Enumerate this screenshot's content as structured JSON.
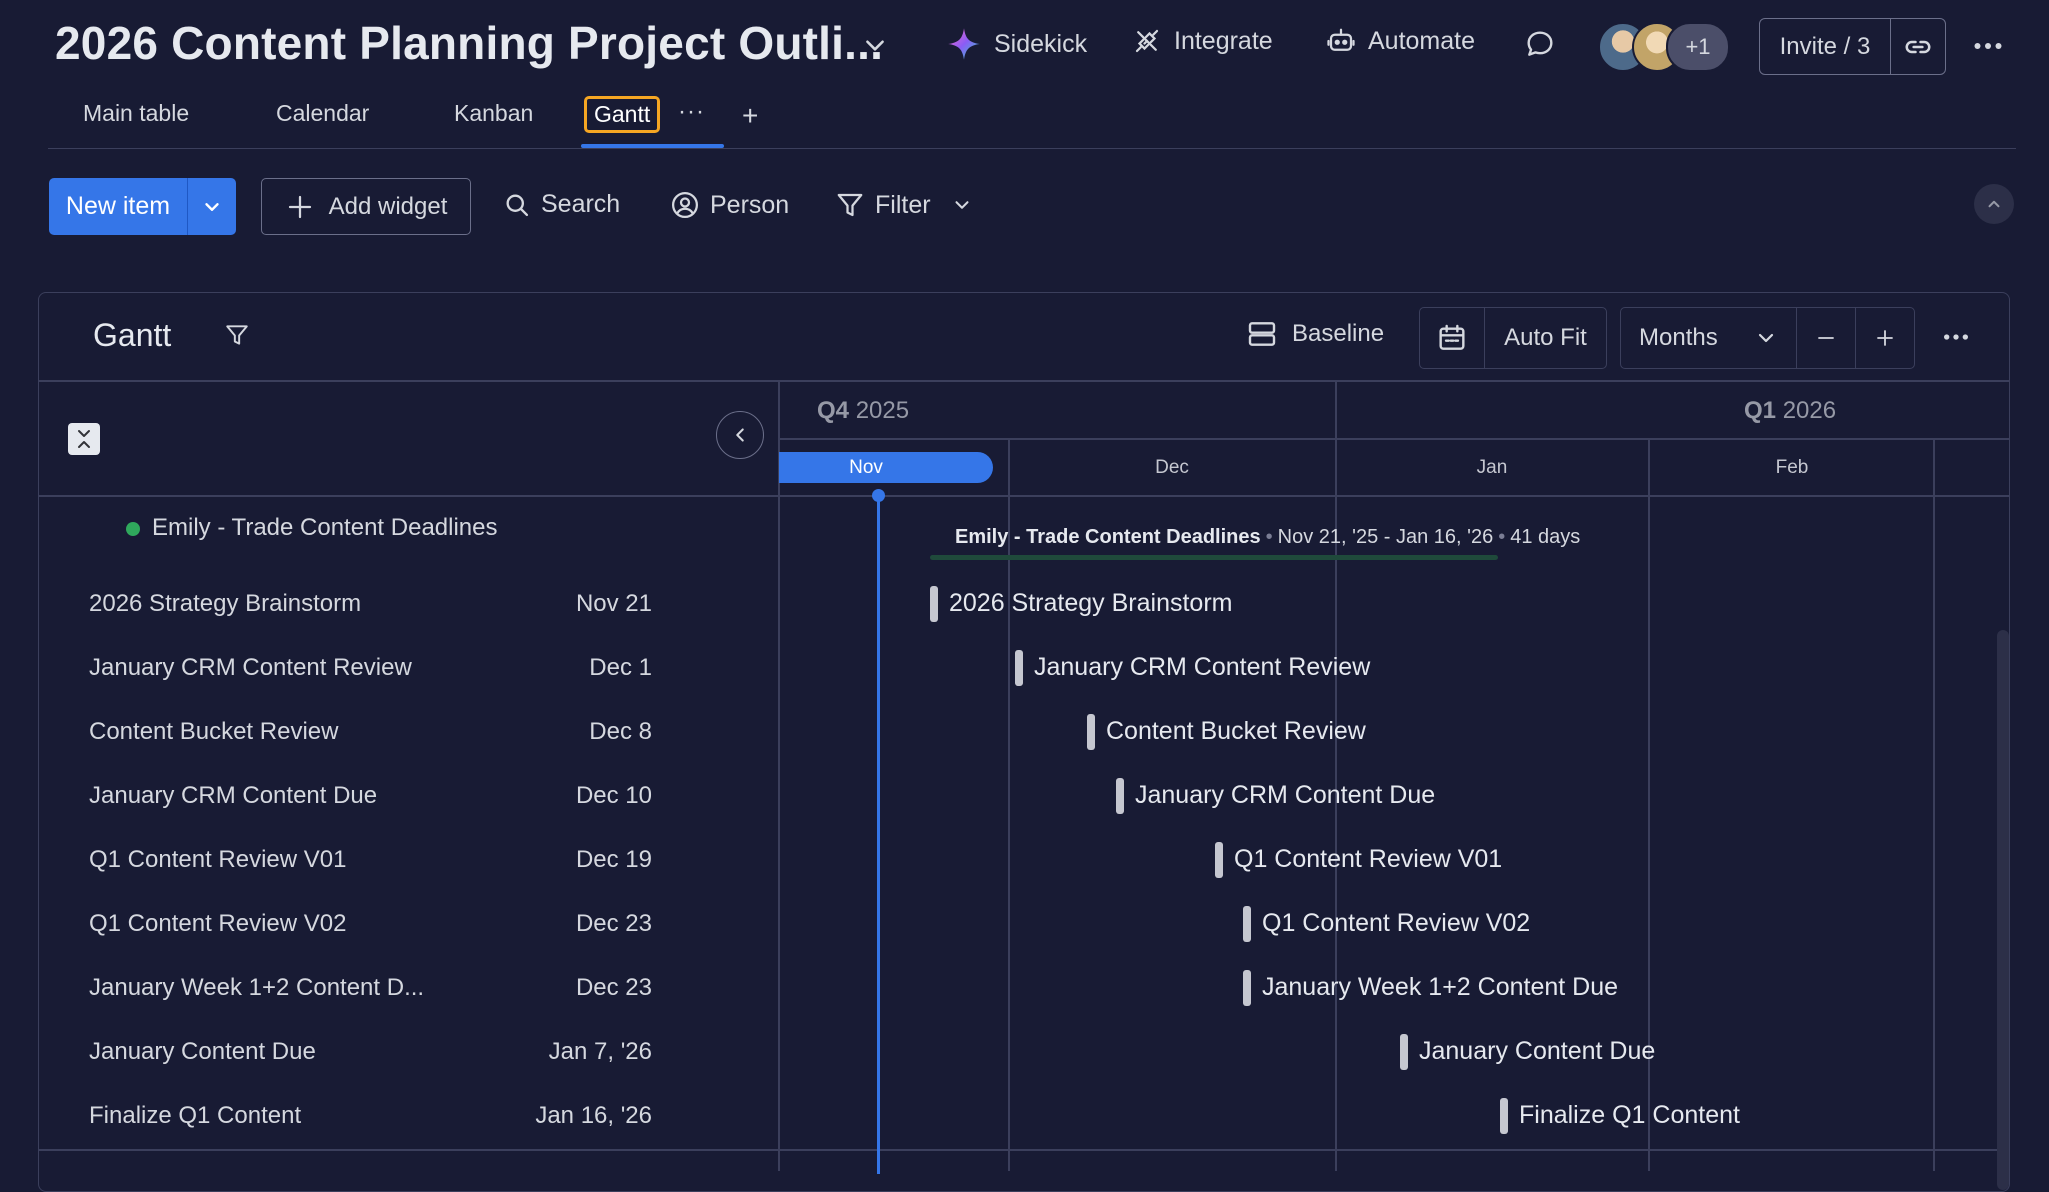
{
  "header": {
    "title": "2026 Content Planning Project Outli...",
    "sidekick_label": "Sidekick",
    "integrate_label": "Integrate",
    "automate_label": "Automate",
    "avatars_more": "+1",
    "invite_label": "Invite / 3"
  },
  "tabs": [
    {
      "label": "Main table"
    },
    {
      "label": "Calendar"
    },
    {
      "label": "Kanban"
    },
    {
      "label": "Gantt",
      "active": true
    }
  ],
  "tab_more": "···",
  "tab_add": "+",
  "toolbar": {
    "new_item_label": "New item",
    "add_widget_label": "Add widget",
    "search_label": "Search",
    "person_label": "Person",
    "filter_label": "Filter"
  },
  "gantt": {
    "title": "Gantt",
    "baseline_label": "Baseline",
    "autofit_label": "Auto Fit",
    "zoom_value": "Months",
    "timeline": {
      "quarters": [
        {
          "q": "Q4",
          "year": "2025"
        },
        {
          "q": "Q1",
          "year": "2026"
        }
      ],
      "months": [
        "Nov",
        "Dec",
        "Jan",
        "Feb"
      ],
      "current_month": "Nov"
    },
    "group": {
      "name": "Emily - Trade Content Deadlines",
      "color": "#2fa85c",
      "range": "Nov 21, '25 - Jan 16, '26",
      "duration": "41 days"
    },
    "items": [
      {
        "name": "2026 Strategy Brainstorm",
        "date": "Nov 21"
      },
      {
        "name": "January CRM Content Review",
        "date": "Dec 1"
      },
      {
        "name": "Content Bucket Review",
        "date": "Dec 8"
      },
      {
        "name": "January CRM Content Due",
        "date": "Dec 10"
      },
      {
        "name": "Q1 Content Review V01",
        "date": "Dec 19"
      },
      {
        "name": "Q1 Content Review V02",
        "date": "Dec 23"
      },
      {
        "name": "January Week 1+2 Content D...",
        "full_name": "January Week 1+2 Content Due",
        "date": "Dec 23"
      },
      {
        "name": "January Content Due",
        "date": "Jan 7, '26"
      },
      {
        "name": "Finalize Q1 Content",
        "date": "Jan 16, '26"
      }
    ]
  },
  "colors": {
    "background": "#181b34",
    "accent": "#3576e8",
    "group": "#2fa85c",
    "active_tab_outline": "#f5a623"
  }
}
